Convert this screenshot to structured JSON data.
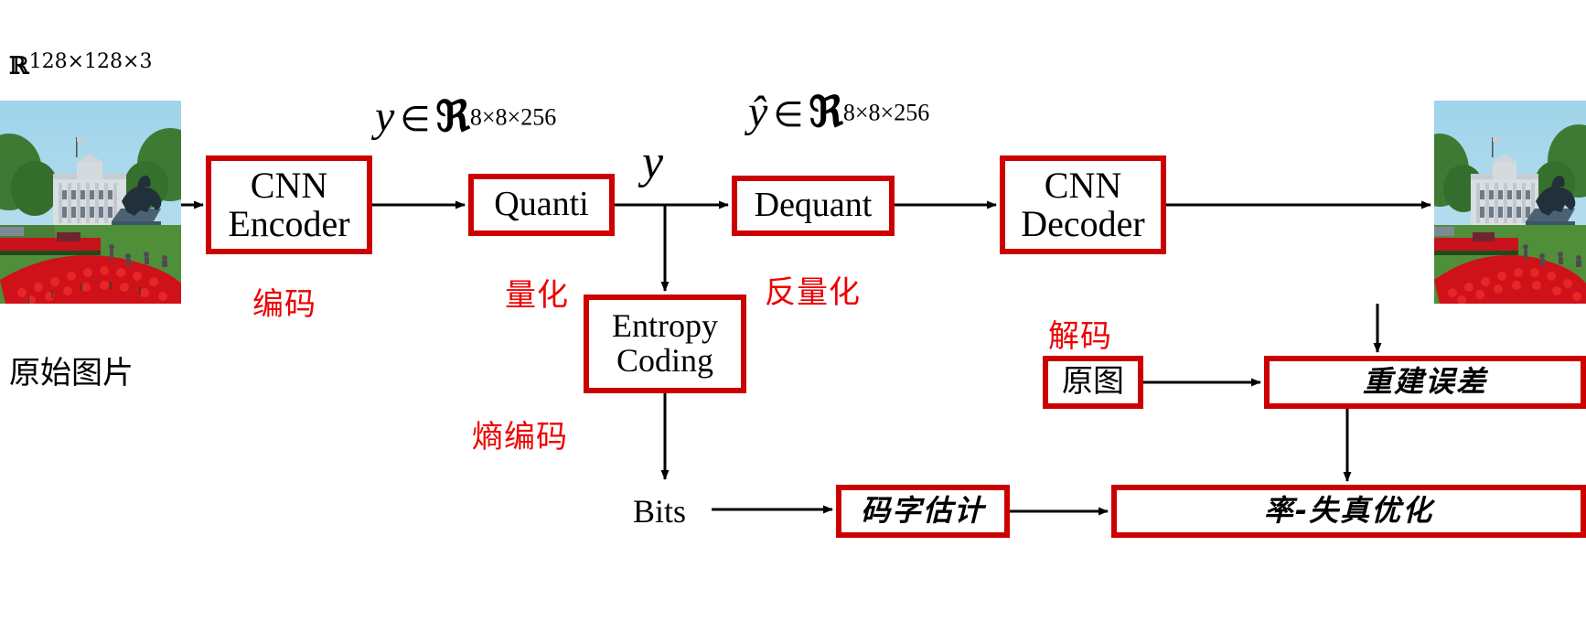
{
  "diagram": {
    "title": "CNN image compression pipeline",
    "accent_color": "#cc0000",
    "annotation_color": "#ee0000"
  },
  "input": {
    "tensor_shape_base": "ℝ",
    "tensor_shape_sup": "128×128×3",
    "caption": "原始图片"
  },
  "math": {
    "y_symbol": "y",
    "y_in": "∈",
    "y_field": "ℜ",
    "y_sup": "8×8×256",
    "yhat_symbol": "ŷ",
    "yhat_in": "∈",
    "yhat_field": "ℜ",
    "yhat_sup": "8×8×256",
    "y_branch_symbol": "y"
  },
  "boxes": {
    "cnn_encoder": "CNN\nEncoder",
    "quanti": "Quanti",
    "entropy_coding": "Entropy\nCoding",
    "dequant": "Dequant",
    "cnn_decoder": "CNN\nDecoder",
    "original_image": "原图",
    "reconstruction_error": "重建误差",
    "codeword_estimation": "码字估计",
    "rate_distortion": "率-失真优化"
  },
  "annotations": {
    "encode": "编码",
    "quantize": "量化",
    "dequantize": "反量化",
    "entropy_code": "熵编码",
    "decode": "解码"
  },
  "labels": {
    "bits": "Bits"
  },
  "photo": {
    "alt": "White House with red tulip garden",
    "sky": "#9cd2e8",
    "building": "#d8dde2",
    "grass": "#4f8f3a",
    "tulips": "#d8111b",
    "trees": "#2f6b2a",
    "statue": "#2b3a4a"
  }
}
